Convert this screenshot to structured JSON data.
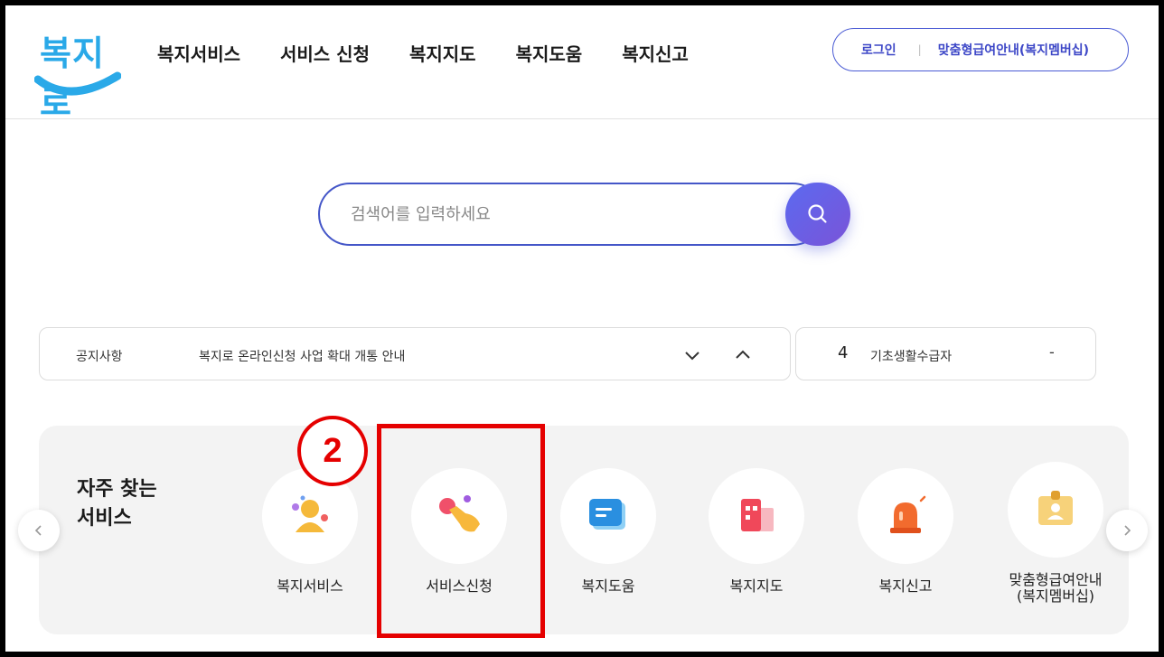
{
  "logo": {
    "text": "복지로",
    "color": "#2aa9e8"
  },
  "nav": {
    "items": [
      "복지서비스",
      "서비스 신청",
      "복지지도",
      "복지도움",
      "복지신고"
    ]
  },
  "user_menu": {
    "login": "로그인",
    "separator": "|",
    "benefit_guide": "맞춤형급여안내(복지멤버십)"
  },
  "search": {
    "placeholder": "검색어를 입력하세요",
    "value": "",
    "button_icon": "search-icon"
  },
  "notice": {
    "tag": "공지사항",
    "text": "복지로 온라인신청 사업 확대 개통 안내"
  },
  "popular": {
    "rank": "4",
    "keyword": "기초생활수급자",
    "trend": "-"
  },
  "frequent": {
    "title_line1": "자주 찾는",
    "title_line2": "서비스",
    "items": [
      {
        "label": "복지서비스",
        "icon": "people-icon"
      },
      {
        "label": "서비스신청",
        "icon": "hand-click-icon"
      },
      {
        "label": "복지도움",
        "icon": "chat-card-icon"
      },
      {
        "label": "복지지도",
        "icon": "building-icon"
      },
      {
        "label": "복지신고",
        "icon": "siren-icon"
      },
      {
        "label_line1": "맞춤형급여안내",
        "label_line2": "(복지멤버십)",
        "icon": "id-card-icon"
      }
    ]
  },
  "annotation": {
    "step_number": "2",
    "color": "#e50000"
  },
  "colors": {
    "accent": "#4456c8",
    "button_gradient_start": "#5b6af0",
    "button_gradient_end": "#7a54d8"
  }
}
